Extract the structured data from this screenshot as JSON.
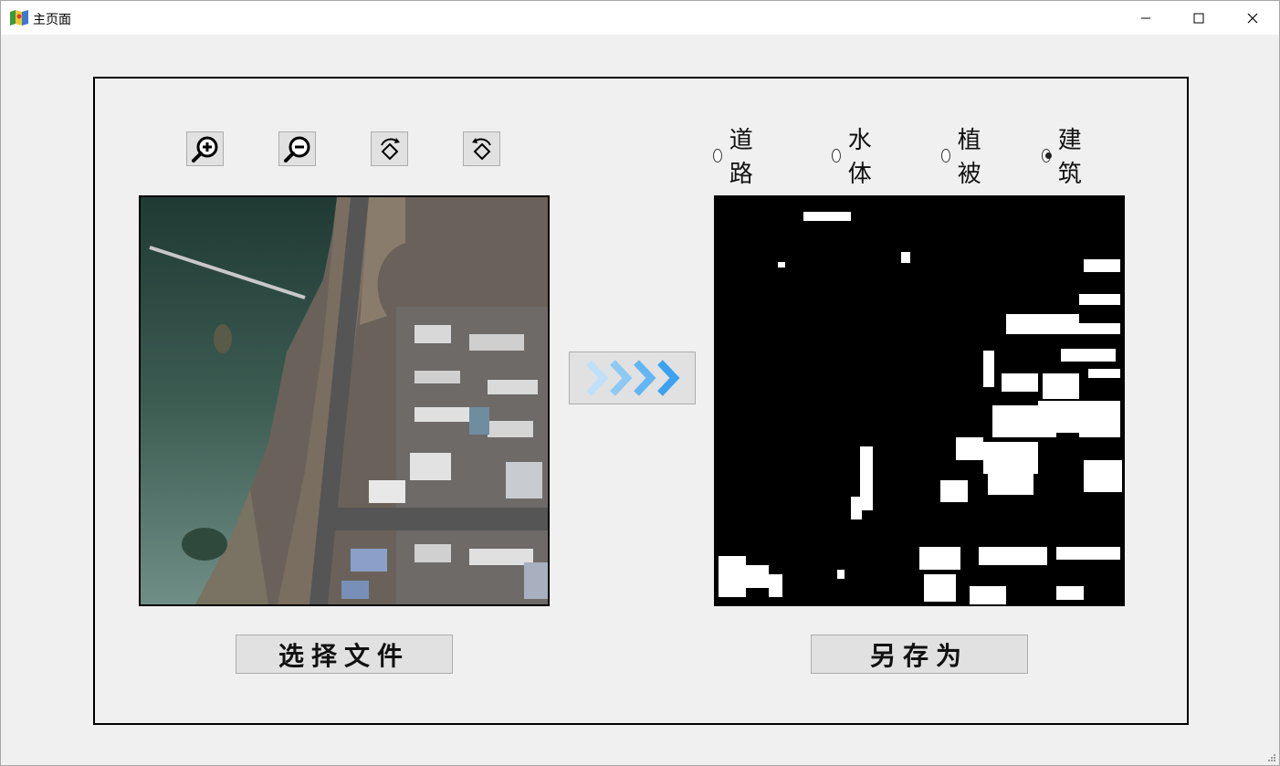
{
  "window": {
    "title": "主页面"
  },
  "toolbar": {
    "zoom_in_icon": "zoom-in-icon",
    "zoom_out_icon": "zoom-out-icon",
    "rotate_left_icon": "rotate-left-icon",
    "rotate_right_icon": "rotate-right-icon"
  },
  "classes": {
    "options": [
      {
        "label": "道路",
        "selected": false
      },
      {
        "label": "水体",
        "selected": false
      },
      {
        "label": "植被",
        "selected": false
      },
      {
        "label": "建筑",
        "selected": true
      }
    ]
  },
  "buttons": {
    "select_file": "选择文件",
    "save_as": "另存为",
    "run_icon": "forward-arrows-icon"
  },
  "colors": {
    "accent": "#4aa8f0",
    "background": "#f0f0f0",
    "button": "#e1e1e1"
  }
}
